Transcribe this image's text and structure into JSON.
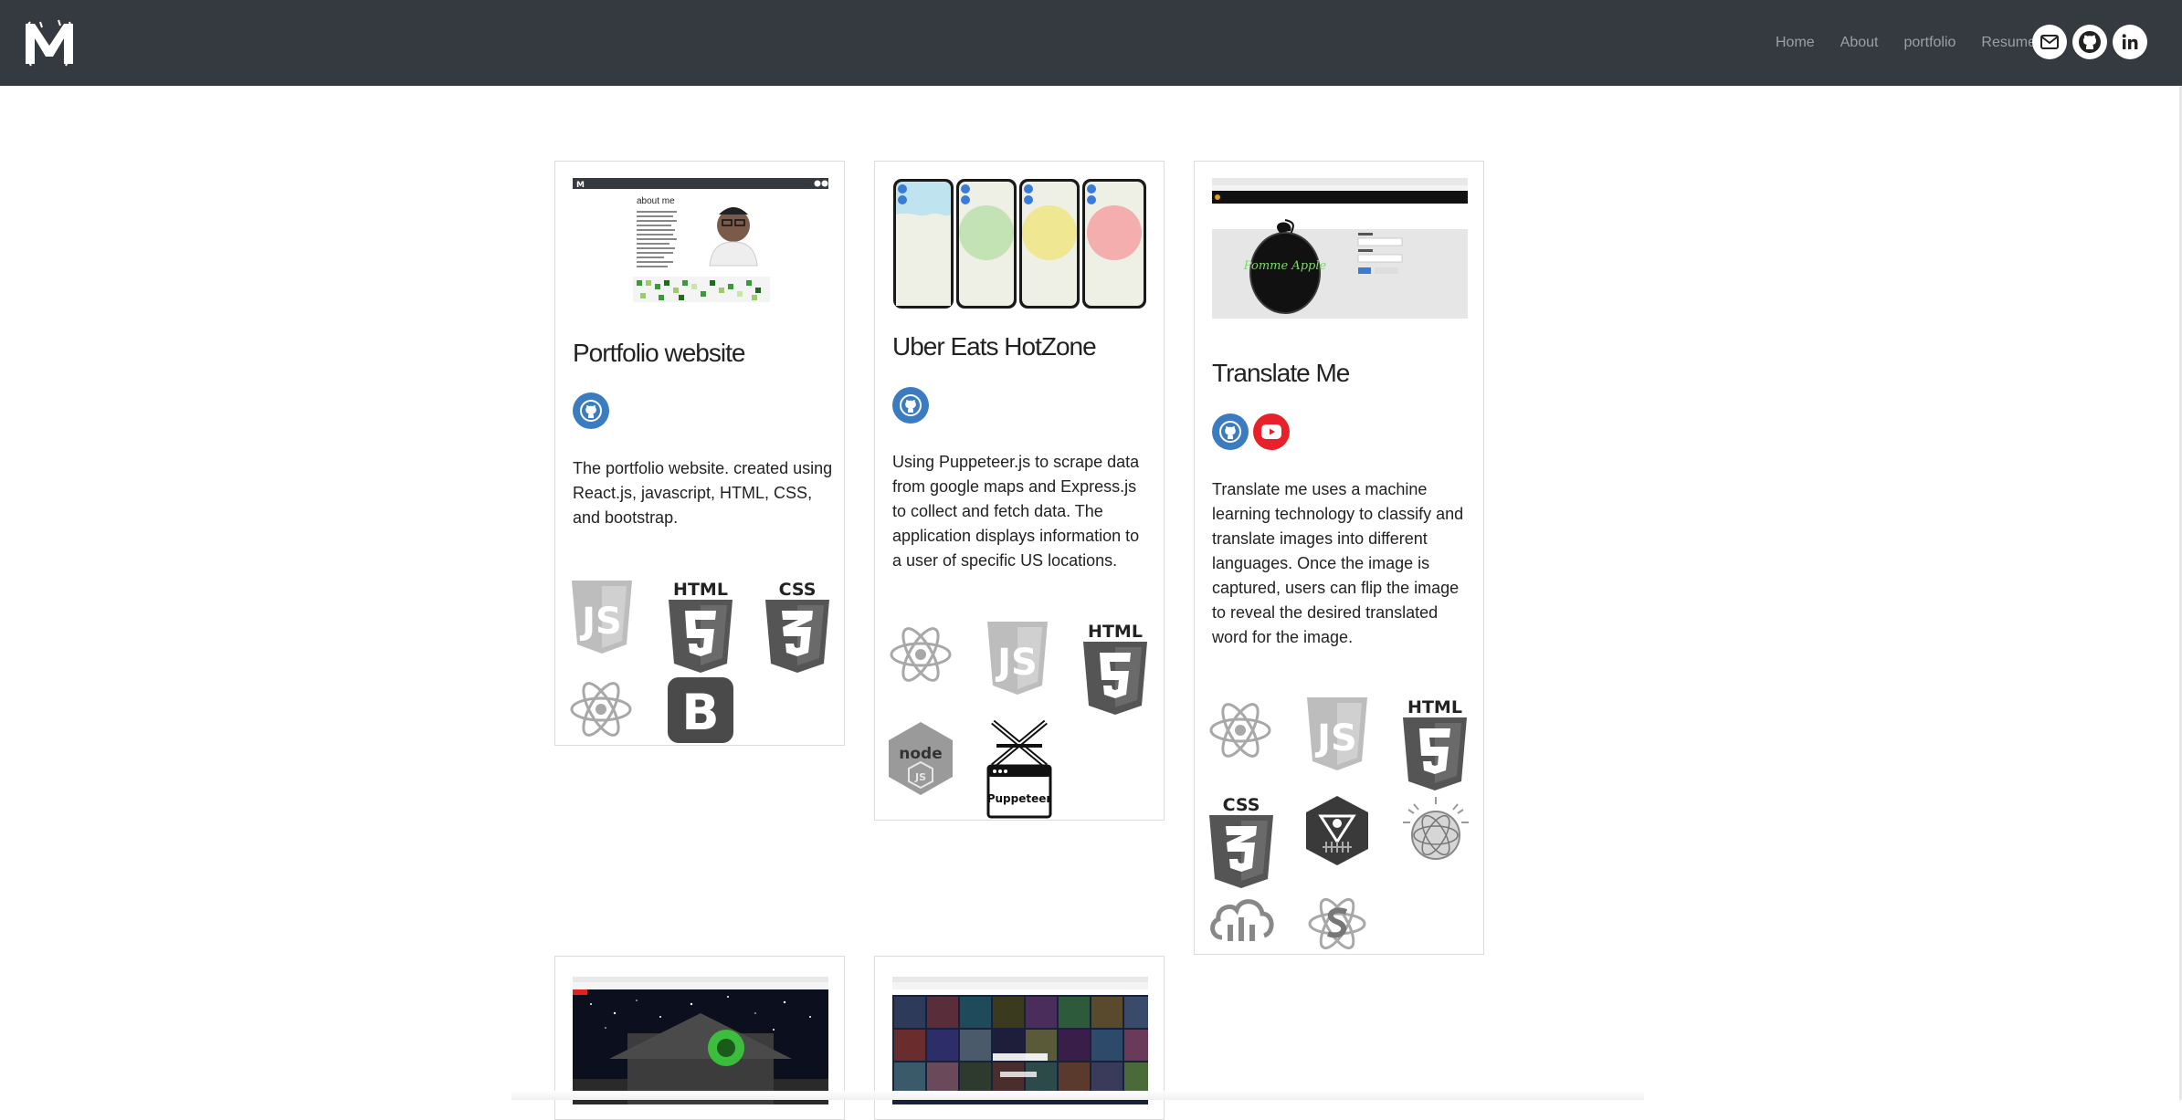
{
  "navbar": {
    "logo_letter": "M",
    "links": [
      "Home",
      "About",
      "portfolio",
      "Resume"
    ],
    "icons": [
      "mail-icon",
      "github-icon",
      "linkedin-icon"
    ],
    "background": "#343a40"
  },
  "projects": [
    {
      "title": "Portfolio website",
      "links": [
        "github-icon"
      ],
      "description": "The portfolio website. created using React.js, javascript, HTML, CSS, and bootstrap.",
      "screenshot_heading": "about me",
      "tech": [
        "javascript-icon",
        "html5-icon",
        "css3-icon",
        "react-icon",
        "bootstrap-icon"
      ]
    },
    {
      "title": "Uber Eats HotZone",
      "links": [
        "github-icon"
      ],
      "description": "Using Puppeteer.js to scrape data from google maps and Express.js to collect and fetch data. The application displays information to a user of specific US locations.",
      "tech": [
        "react-icon",
        "javascript-icon",
        "html5-icon",
        "nodejs-icon",
        "puppeteer-icon"
      ],
      "puppeteer_label": "Puppeteer",
      "node_label": "node"
    },
    {
      "title": "Translate Me",
      "links": [
        "github-icon",
        "youtube-icon"
      ],
      "description": "Translate me uses a machine learning technology to classify and translate images into different languages. Once the image is captured, users can flip the image to reveal the desired translated word for the image.",
      "screenshot_text": "Pomme Apple",
      "tech": [
        "react-icon",
        "javascript-icon",
        "html5-icon",
        "css3-icon",
        "ml5-icon",
        "watson-icon",
        "cloud-icon",
        "saga-icon"
      ]
    },
    {
      "title": "",
      "tech": []
    },
    {
      "title": "",
      "tech": []
    }
  ],
  "badges": {
    "html": "HTML",
    "css": "CSS",
    "js": "JS",
    "bootstrap": "B"
  },
  "colors": {
    "github": "#3b7bbf",
    "youtube": "#e8202a",
    "tech_grey": "#555555"
  }
}
